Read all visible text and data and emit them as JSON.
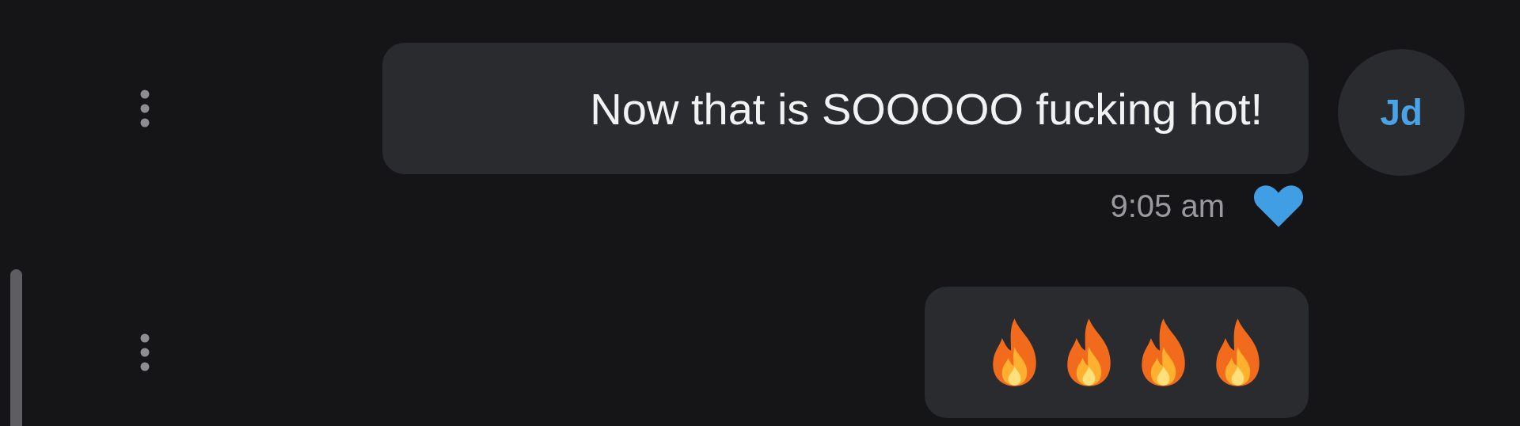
{
  "messages": [
    {
      "kind": "text",
      "avatar": "Jd",
      "text": "Now that is SOOOOO fucking hot!",
      "liked": true,
      "time": "9:05 am"
    },
    {
      "kind": "fire"
    }
  ]
}
